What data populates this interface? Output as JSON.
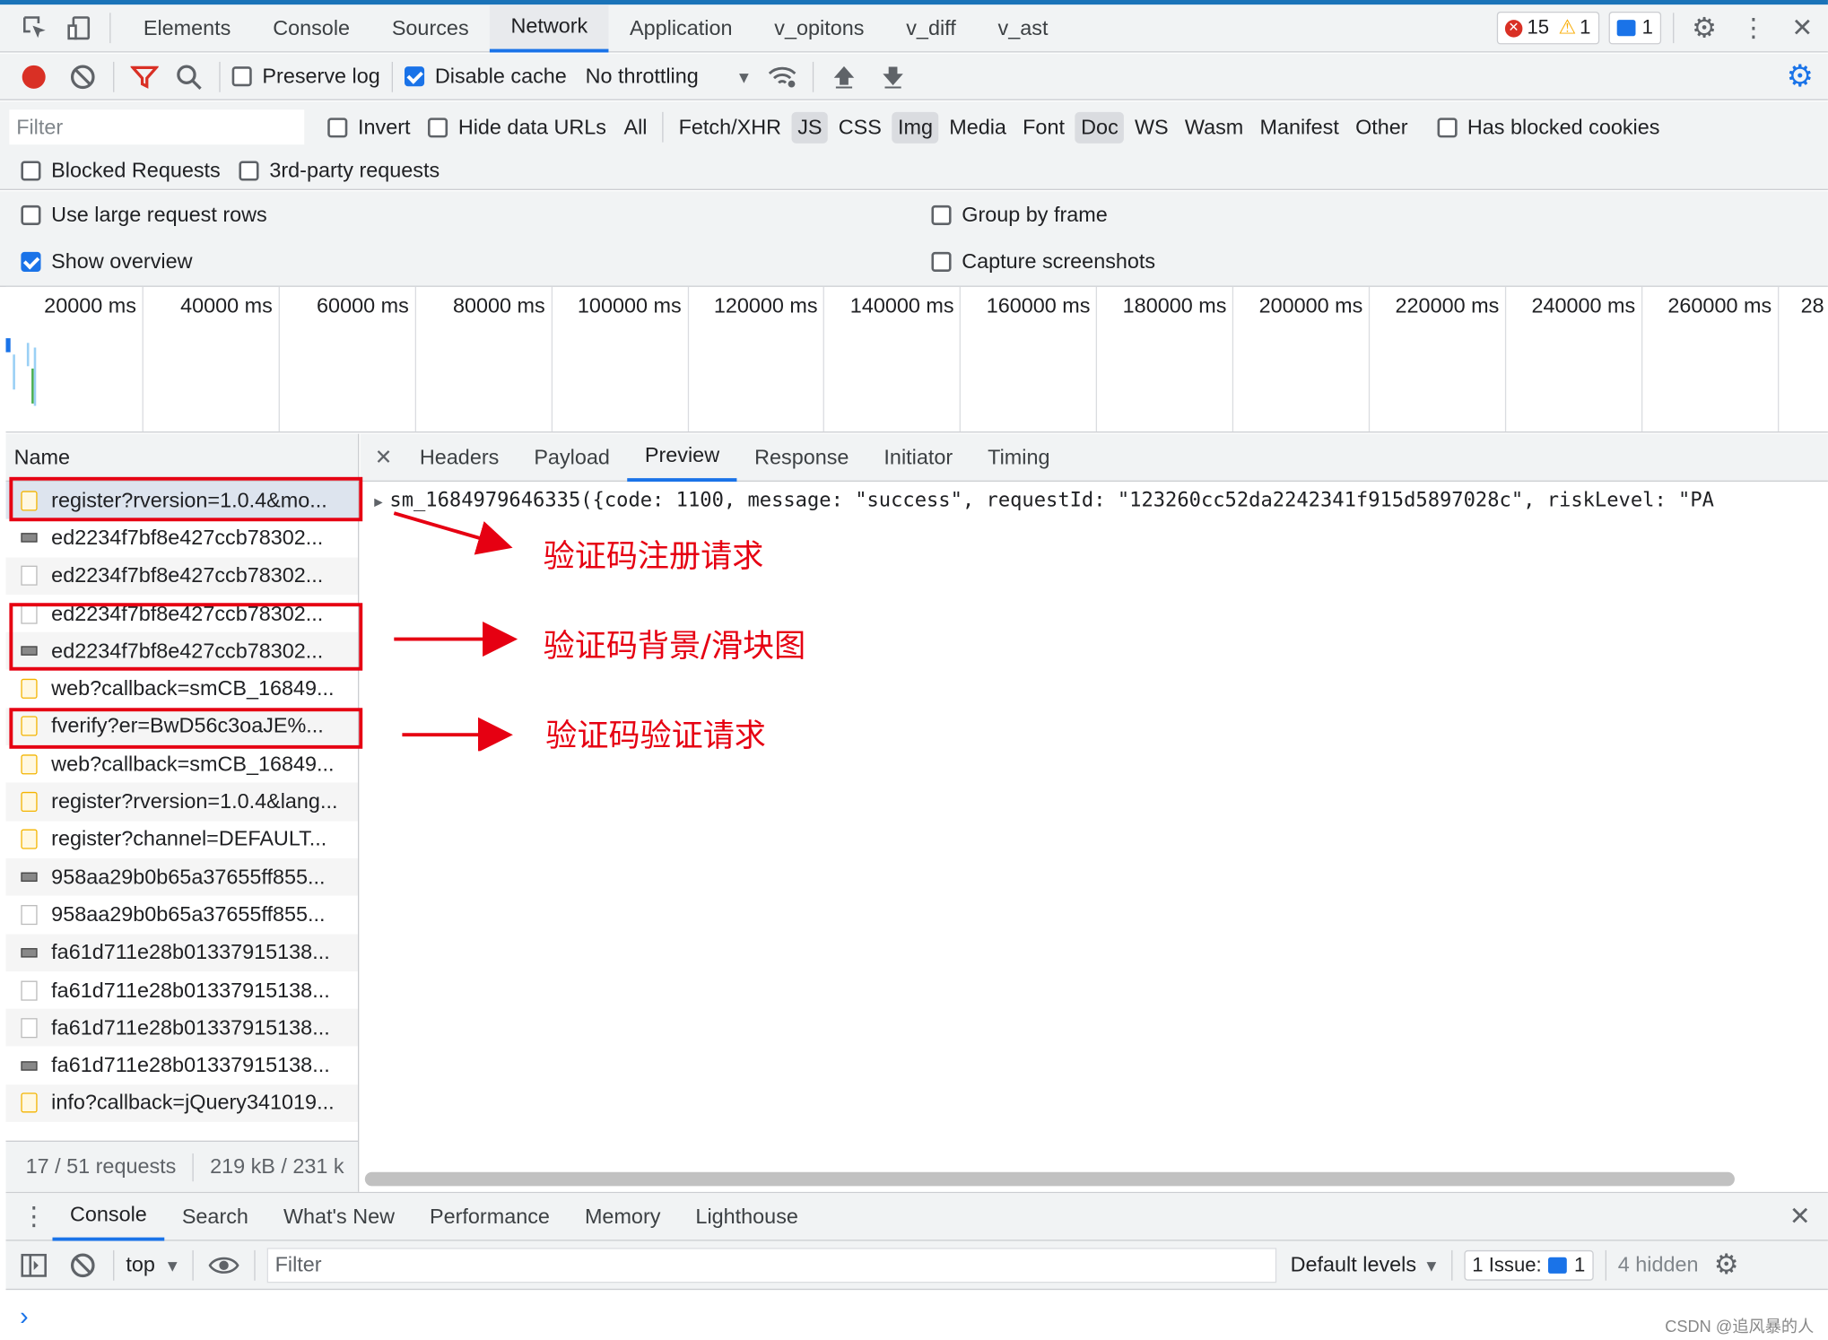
{
  "main_tabs": [
    "Elements",
    "Console",
    "Sources",
    "Network",
    "Application",
    "v_opitons",
    "v_diff",
    "v_ast"
  ],
  "active_tab": "Network",
  "status_counts": {
    "errors": "15",
    "warnings": "1",
    "messages": "1"
  },
  "toolbar": {
    "preserve_log": "Preserve log",
    "disable_cache": "Disable cache",
    "throttling": "No throttling"
  },
  "filter": {
    "placeholder": "Filter",
    "invert": "Invert",
    "hide_data_urls": "Hide data URLs",
    "types": [
      "All",
      "Fetch/XHR",
      "JS",
      "CSS",
      "Img",
      "Media",
      "Font",
      "Doc",
      "WS",
      "Wasm",
      "Manifest",
      "Other"
    ],
    "types_on": [
      "JS",
      "Img",
      "Doc"
    ],
    "has_blocked_cookies": "Has blocked cookies",
    "blocked_requests": "Blocked Requests",
    "third_party": "3rd-party requests"
  },
  "settings": {
    "large_rows": "Use large request rows",
    "group_by_frame": "Group by frame",
    "show_overview": "Show overview",
    "capture_screenshots": "Capture screenshots"
  },
  "overview_ticks": [
    "20000 ms",
    "40000 ms",
    "60000 ms",
    "80000 ms",
    "100000 ms",
    "120000 ms",
    "140000 ms",
    "160000 ms",
    "180000 ms",
    "200000 ms",
    "220000 ms",
    "240000 ms",
    "260000 ms",
    "28"
  ],
  "requests": {
    "header": "Name",
    "items": [
      {
        "name": "register?rversion=1.0.4&mo...",
        "type": "js"
      },
      {
        "name": "ed2234f7bf8e427ccb78302...",
        "type": "img"
      },
      {
        "name": "ed2234f7bf8e427ccb78302...",
        "type": "blank"
      },
      {
        "name": "ed2234f7bf8e427ccb78302...",
        "type": "blank"
      },
      {
        "name": "ed2234f7bf8e427ccb78302...",
        "type": "img"
      },
      {
        "name": "web?callback=smCB_16849...",
        "type": "js"
      },
      {
        "name": "fverify?er=BwD56c3oaJE%...",
        "type": "js"
      },
      {
        "name": "web?callback=smCB_16849...",
        "type": "js"
      },
      {
        "name": "register?rversion=1.0.4&lang...",
        "type": "js"
      },
      {
        "name": "register?channel=DEFAULT...",
        "type": "js"
      },
      {
        "name": "958aa29b0b65a37655ff855...",
        "type": "img"
      },
      {
        "name": "958aa29b0b65a37655ff855...",
        "type": "blank"
      },
      {
        "name": "fa61d711e28b01337915138...",
        "type": "img"
      },
      {
        "name": "fa61d711e28b01337915138...",
        "type": "blank"
      },
      {
        "name": "fa61d711e28b01337915138...",
        "type": "blank"
      },
      {
        "name": "fa61d711e28b01337915138...",
        "type": "img"
      },
      {
        "name": "info?callback=jQuery341019...",
        "type": "js"
      }
    ],
    "footer_count": "17 / 51 requests",
    "footer_size": "219 kB / 231 k"
  },
  "detail_tabs": [
    "Headers",
    "Payload",
    "Preview",
    "Response",
    "Initiator",
    "Timing"
  ],
  "active_detail_tab": "Preview",
  "preview_text": "sm_1684979646335({code: 1100, message: \"success\", requestId: \"123260cc52da2242341f915d5897028c\", riskLevel: \"PA",
  "annotations": [
    "验证码注册请求",
    "验证码背景/滑块图",
    "验证码验证请求"
  ],
  "drawer": {
    "tabs": [
      "Console",
      "Search",
      "What's New",
      "Performance",
      "Memory",
      "Lighthouse"
    ],
    "active": "Console",
    "context": "top",
    "filter_placeholder": "Filter",
    "levels": "Default levels",
    "issues_label": "1 Issue:",
    "issues_count": "1",
    "hidden": "4 hidden",
    "prompt": "›"
  },
  "watermark": "CSDN @追风暴的人",
  "colors": {
    "accent": "#1a73e8",
    "error": "#d93025",
    "warning": "#f9ab00",
    "annotation": "#e60012"
  }
}
